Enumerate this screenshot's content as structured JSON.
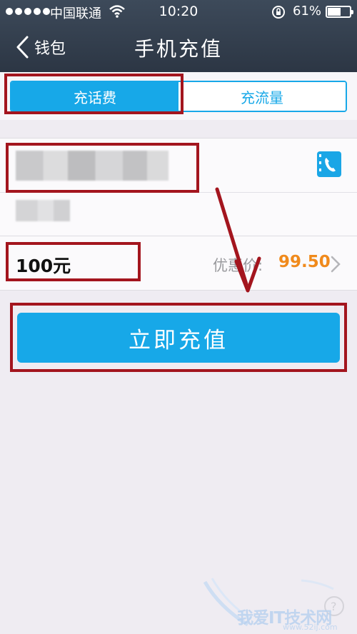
{
  "status_bar": {
    "carrier": "中国联通",
    "time": "10:20",
    "battery_percent": "61%",
    "battery_level": 0.61
  },
  "nav": {
    "back_label": "钱包",
    "title": "手机充值"
  },
  "tabs": [
    {
      "label": "充话费",
      "active": true
    },
    {
      "label": "充流量",
      "active": false
    }
  ],
  "phone": {
    "number_value": "",
    "contact_icon": "phone-contact-icon"
  },
  "amount": {
    "value": "100元",
    "price_label": "优惠价:",
    "price_value": "99.50"
  },
  "actions": {
    "recharge_label": "立即充值"
  },
  "watermark": {
    "text": "我爱IT技术网",
    "sub": "www.52ij.com"
  },
  "colors": {
    "accent": "#17a8e8",
    "annotation": "#a3151e",
    "price": "#f08a1c",
    "nav_bg": "#2c3644"
  }
}
